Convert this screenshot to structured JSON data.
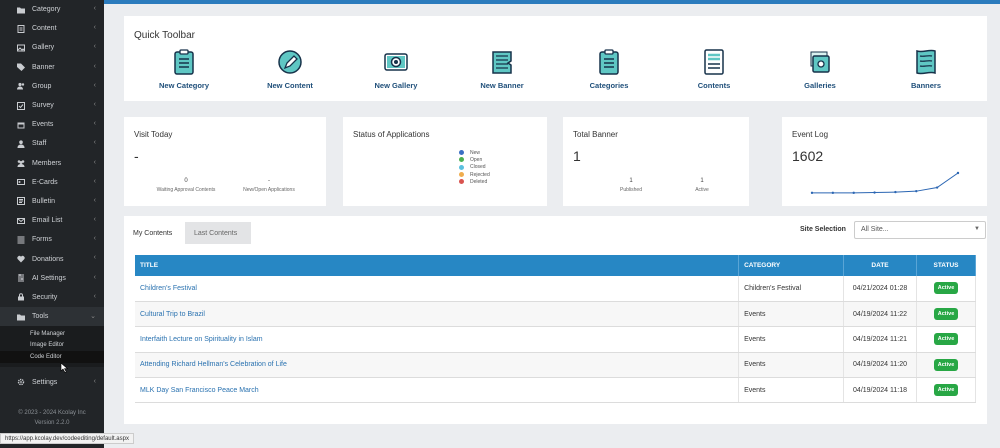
{
  "sidebar": {
    "items": [
      {
        "label": "Category",
        "icon": "folder-icon"
      },
      {
        "label": "Content",
        "icon": "file-icon"
      },
      {
        "label": "Gallery",
        "icon": "image-icon"
      },
      {
        "label": "Banner",
        "icon": "tag-icon"
      },
      {
        "label": "Group",
        "icon": "users-icon"
      },
      {
        "label": "Survey",
        "icon": "checklist-icon"
      },
      {
        "label": "Events",
        "icon": "calendar-icon"
      },
      {
        "label": "Staff",
        "icon": "staff-icon"
      },
      {
        "label": "Members",
        "icon": "members-icon"
      },
      {
        "label": "E-Cards",
        "icon": "card-icon"
      },
      {
        "label": "Bulletin",
        "icon": "bulletin-icon"
      },
      {
        "label": "Email List",
        "icon": "envelope-icon"
      },
      {
        "label": "Forms",
        "icon": "form-icon"
      },
      {
        "label": "Donations",
        "icon": "donation-icon"
      },
      {
        "label": "AI Settings",
        "icon": "ai-icon"
      },
      {
        "label": "Security",
        "icon": "lock-icon"
      },
      {
        "label": "Tools",
        "icon": "folder-icon"
      }
    ],
    "submenu": [
      "File Manager",
      "Image Editor",
      "Code Editor"
    ],
    "settings_label": "Settings",
    "footer_line1": "© 2023 - 2024 Kcolay Inc",
    "footer_line2": "Version 2.2.0"
  },
  "url_status": "https://app.kcolay.dev/codeediting/default.aspx",
  "quick_toolbar": {
    "title": "Quick Toolbar",
    "items": [
      {
        "label": "New Category",
        "icon": "clipboard-icon"
      },
      {
        "label": "New Content",
        "icon": "pencil-circle-icon"
      },
      {
        "label": "New Gallery",
        "icon": "camera-icon"
      },
      {
        "label": "New Banner",
        "icon": "flag-icon"
      },
      {
        "label": "Categories",
        "icon": "clipboard-icon"
      },
      {
        "label": "Contents",
        "icon": "document-icon"
      },
      {
        "label": "Galleries",
        "icon": "photo-stack-icon"
      },
      {
        "label": "Banners",
        "icon": "banners-icon"
      }
    ]
  },
  "cards": {
    "visit_today": {
      "title": "Visit Today",
      "value": "-",
      "stat1_value": "0",
      "stat1_label": "Waiting Approval Contents",
      "stat2_value": "-",
      "stat2_label": "New/Open Applications"
    },
    "applications": {
      "title": "Status of Applications",
      "legend": [
        {
          "label": "New",
          "color": "#3b6fc4"
        },
        {
          "label": "Open",
          "color": "#4caf50"
        },
        {
          "label": "Closed",
          "color": "#5bc0de"
        },
        {
          "label": "Rejected",
          "color": "#f0ad4e"
        },
        {
          "label": "Deleted",
          "color": "#d9534f"
        }
      ]
    },
    "total_banner": {
      "title": "Total Banner",
      "value": "1",
      "stat1_value": "1",
      "stat1_label": "Published",
      "stat2_value": "1",
      "stat2_label": "Active"
    },
    "event_log": {
      "title": "Event Log",
      "value": "1602",
      "line_color": "#2b66b3"
    }
  },
  "chart_data": {
    "type": "line",
    "values": [
      2,
      2,
      2,
      5,
      10,
      20,
      60,
      220
    ]
  },
  "main": {
    "tabs": [
      "My Contents",
      "Last Contents"
    ],
    "site_label": "Site Selection",
    "site_value": "All Site...",
    "columns": [
      "TITLE",
      "CATEGORY",
      "DATE",
      "STATUS"
    ],
    "rows": [
      {
        "title": "Children's Festival",
        "category": "Children's Festival",
        "date": "04/21/2024 01:28",
        "status": "Active"
      },
      {
        "title": "Cultural Trip to Brazil",
        "category": "Events",
        "date": "04/19/2024 11:22",
        "status": "Active"
      },
      {
        "title": "Interfaith Lecture on Spirituality in Islam",
        "category": "Events",
        "date": "04/19/2024 11:21",
        "status": "Active"
      },
      {
        "title": "Attending Richard Hellman's Celebration of Life",
        "category": "Events",
        "date": "04/19/2024 11:20",
        "status": "Active"
      },
      {
        "title": "MLK Day San Francisco Peace March",
        "category": "Events",
        "date": "04/19/2024 11:18",
        "status": "Active"
      }
    ],
    "status_color": "#28a745",
    "header_color": "#2787c4"
  }
}
